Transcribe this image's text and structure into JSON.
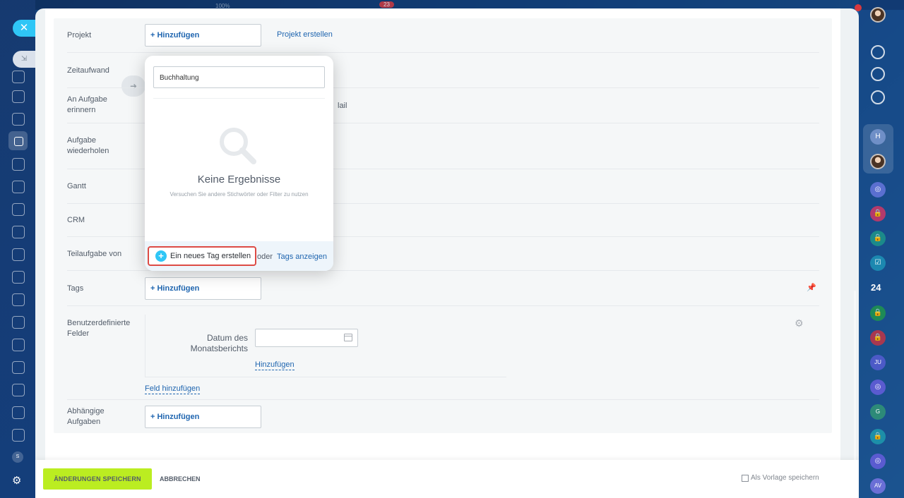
{
  "topbar": {
    "zoom_text": "100%",
    "counter": "23"
  },
  "left_rail": {
    "badge": "S"
  },
  "right_rail": {
    "b24_label": "24",
    "items": [
      "H",
      "JU",
      "G",
      "AV"
    ]
  },
  "form": {
    "project": {
      "label": "Projekt",
      "add": "+ Hinzufügen",
      "create_link": "Projekt erstellen"
    },
    "time": {
      "label": "Zeitaufwand"
    },
    "remind": {
      "label": "An Aufgabe erinnern",
      "tail_text": "lail"
    },
    "repeat": {
      "label": "Aufgabe wiederholen"
    },
    "gantt": {
      "label": "Gantt"
    },
    "crm": {
      "label": "CRM"
    },
    "subtask": {
      "label": "Teilaufgabe von"
    },
    "tags": {
      "label": "Tags",
      "add": "+ Hinzufügen"
    },
    "custom_fields": {
      "label": "Benutzerdefinierte Felder",
      "field_label": "Datum des Monatsberichts",
      "date_value": "",
      "add_value": "Hinzufügen",
      "add_field": "Feld hinzufügen"
    },
    "dependent": {
      "label": "Abhängige Aufgaben",
      "add": "+ Hinzufügen"
    }
  },
  "tag_popup": {
    "search_value": "Buchhaltung",
    "empty_title": "Keine Ergebnisse",
    "empty_subtitle": "Versuchen Sie andere Stichwörter oder Filter zu nutzen",
    "create_label": "Ein neues Tag erstellen",
    "or_text": "oder",
    "show_tags": "Tags anzeigen"
  },
  "footer": {
    "save": "ÄNDERUNGEN SPEICHERN",
    "cancel": "ABBRECHEN",
    "save_template": "Als Vorlage speichern"
  },
  "colors": {
    "accent_blue": "#2fc6f6",
    "link": "#2066b0",
    "save_green": "#bbed21",
    "highlight_red": "#dd4b45"
  }
}
